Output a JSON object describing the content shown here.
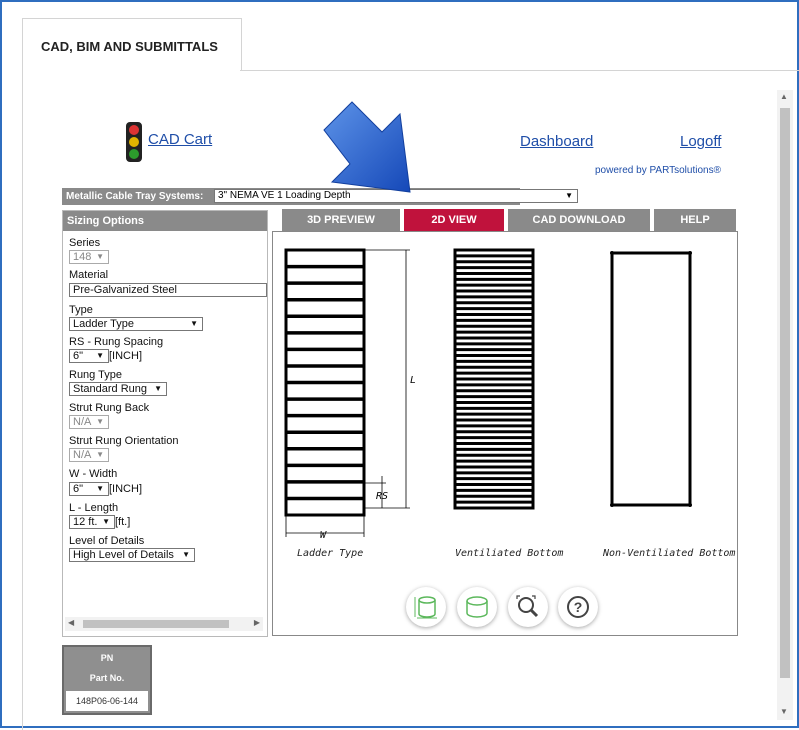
{
  "main_tab": {
    "label": "CAD, BIM AND SUBMITTALS"
  },
  "header": {
    "cad_cart": "CAD Cart",
    "dashboard": "Dashboard",
    "logoff": "Logoff",
    "powered_by": "powered by PARTsolutions®"
  },
  "series_bar": {
    "label": "Metallic Cable Tray Systems:",
    "selected": "3\" NEMA VE 1 Loading Depth"
  },
  "sizing": {
    "header": "Sizing Options",
    "series_label": "Series",
    "series_value": "148",
    "material_label": "Material",
    "material_value": "Pre-Galvanized Steel",
    "type_label": "Type",
    "type_value": "Ladder Type",
    "rs_label": "RS - Rung Spacing",
    "rs_value": "6\"",
    "rs_unit": "[INCH]",
    "rung_type_label": "Rung Type",
    "rung_type_value": "Standard Rung",
    "strut_back_label": "Strut Rung Back",
    "strut_back_value": "N/A",
    "strut_orient_label": "Strut Rung Orientation",
    "strut_orient_value": "N/A",
    "width_label": "W - Width",
    "width_value": "6\"",
    "width_unit": "[INCH]",
    "length_label": "L - Length",
    "length_value": "12 ft.",
    "length_unit": "[ft.]",
    "lod_label": "Level of Details",
    "lod_value": "High Level of Details"
  },
  "view_tabs": [
    "3D PREVIEW",
    "2D VIEW",
    "CAD DOWNLOAD",
    "HELP"
  ],
  "active_view_tab": "2D VIEW",
  "drawing": {
    "captions": [
      "Ladder Type",
      "Ventiliated Bottom",
      "Non-Ventiliated Bottom"
    ],
    "dim_L": "L",
    "dim_RS": "RS",
    "dim_W": "W"
  },
  "part": {
    "pn": "PN",
    "part_no": "Part No.",
    "value": "148P06-06-144"
  },
  "colors": {
    "active_tab": "#c0123c",
    "inactive_tab": "#8a8a8a",
    "link": "#1f4ea8",
    "arrow": "#1f5fc8"
  }
}
